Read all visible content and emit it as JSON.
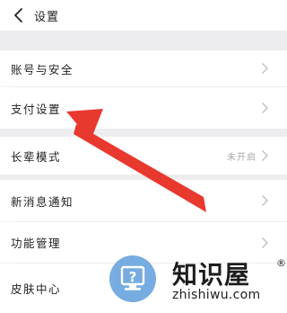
{
  "header": {
    "title": "设置"
  },
  "settings": {
    "items": [
      {
        "label": "账号与安全"
      },
      {
        "label": "支付设置"
      },
      {
        "label": "长辈模式",
        "value": "未开启"
      },
      {
        "label": "新消息通知"
      },
      {
        "label": "功能管理"
      },
      {
        "label": "皮肤中心"
      }
    ]
  },
  "annotation": {
    "arrow_color": "#e8392f"
  },
  "watermark": {
    "brand": "知识屋",
    "reg": "®",
    "url": "zhishiwu.com",
    "icon": "question-monitor-icon"
  }
}
